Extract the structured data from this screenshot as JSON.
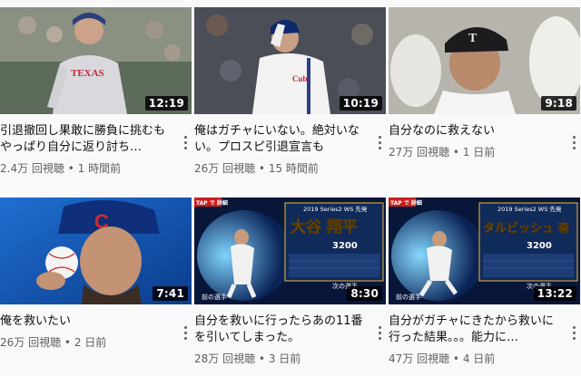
{
  "videos": [
    {
      "title": "引退撤回し果敢に勝負に挑むもやっぱり自分に返り討ち…",
      "views": "2.4万 回視聴",
      "age": "1 時間前",
      "duration": "12:19",
      "thumb": "texas-pitcher"
    },
    {
      "title": "俺はガチャにいない。絶対いない。プロスピ引退宣言も",
      "views": "26万 回視聴",
      "age": "15 時間前",
      "duration": "10:19",
      "thumb": "cubs-pitcher-cap"
    },
    {
      "title": "自分なのに救えない",
      "views": "27万 回視聴",
      "age": "1 日前",
      "duration": "9:18",
      "thumb": "crying-player"
    },
    {
      "title": "俺を救いたい",
      "views": "26万 回視聴",
      "age": "2 日前",
      "duration": "7:41",
      "thumb": "cubs-portrait-ball"
    },
    {
      "title": "自分を救いに行ったらあの11番を引いてしまった。",
      "views": "28万 回視聴",
      "age": "3 日前",
      "duration": "8:30",
      "thumb": "game-card-otani",
      "card_name": "大谷 翔平",
      "card_top": "2019 Series2 WS 先発",
      "card_stat": "3200",
      "card_tag": "TAP で 詳細",
      "card_prev": "前の選手",
      "card_next": "次の選手"
    },
    {
      "title": "自分がガチャにきたから救いに行った結果。。。能力に…",
      "views": "47万 回視聴",
      "age": "4 日前",
      "duration": "13:22",
      "thumb": "game-card-darvish",
      "card_name": "タルビッシュ 有",
      "card_top": "2019 Series2 WS 先発",
      "card_stat": "3200",
      "card_tag": "TAP で 詳細",
      "card_prev": "前の選手",
      "card_next": "次の選手"
    }
  ],
  "separator": " • ",
  "colors": {
    "meta_text": "#606060",
    "background": "#f9f9f9",
    "duration_bg": "#000000"
  }
}
